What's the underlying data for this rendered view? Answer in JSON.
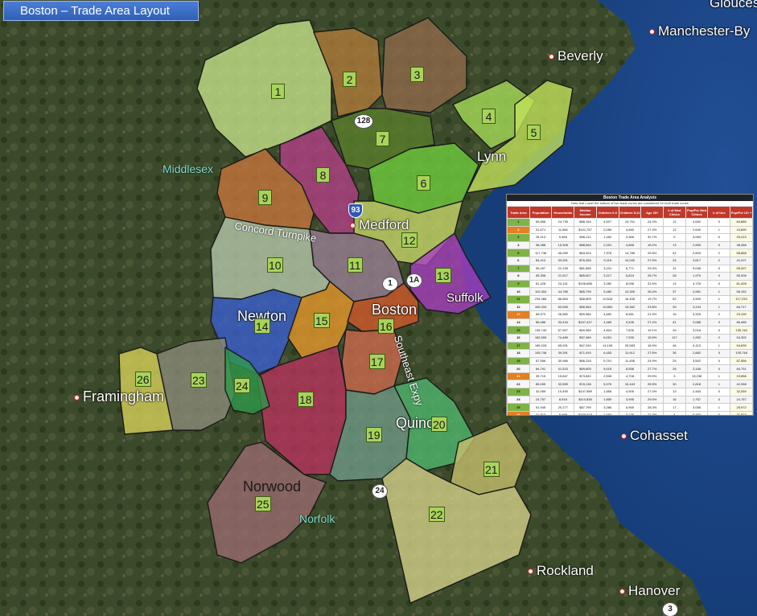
{
  "title": "Boston – Trade Area Layout",
  "colors": {
    "land_dark": "#2d3b22",
    "water": "#1d4b8e",
    "zone_label_bg": "#a8d35a",
    "table_header": "#c0392b"
  },
  "zones": [
    {
      "id": "1",
      "color": "#c6e48a"
    },
    {
      "id": "2",
      "color": "#b07b3a"
    },
    {
      "id": "3",
      "color": "#8f6a4a"
    },
    {
      "id": "4",
      "color": "#a6df5a"
    },
    {
      "id": "5",
      "color": "#c3e35a"
    },
    {
      "id": "6",
      "color": "#6fce3e"
    },
    {
      "id": "7",
      "color": "#5a7f2b"
    },
    {
      "id": "8",
      "color": "#b43f86"
    },
    {
      "id": "9",
      "color": "#c8743c"
    },
    {
      "id": "10",
      "color": "#b7c9ad"
    },
    {
      "id": "11",
      "color": "#9a7f96"
    },
    {
      "id": "12",
      "color": "#c8d86a"
    },
    {
      "id": "13",
      "color": "#a63ec0"
    },
    {
      "id": "14",
      "color": "#3a5fd2"
    },
    {
      "id": "15",
      "color": "#e8982a"
    },
    {
      "id": "16",
      "color": "#d4582a"
    },
    {
      "id": "17",
      "color": "#cf6a4e"
    },
    {
      "id": "18",
      "color": "#b8325e"
    },
    {
      "id": "19",
      "color": "#6f9a86"
    },
    {
      "id": "20",
      "color": "#4fb86e"
    },
    {
      "id": "21",
      "color": "#c8c06e"
    },
    {
      "id": "22",
      "color": "#d6d48a"
    },
    {
      "id": "23",
      "color": "#8c8c7a"
    },
    {
      "id": "24",
      "color": "#2f9a4a"
    },
    {
      "id": "25",
      "color": "#9a6a70"
    },
    {
      "id": "26",
      "color": "#d8d45a"
    }
  ],
  "places": {
    "gloucester": "Glouces",
    "manchester": "Manchester-By",
    "beverly": "Beverly",
    "lynn": "Lynn",
    "middlesex": "Middlesex",
    "medford": "Medford",
    "concord_turnpike": "Concord Turnpike",
    "suffolk": "Suffolk",
    "newton": "Newton",
    "boston": "Boston",
    "southeast_expy": "Southeast Expy",
    "framingham": "Framingham",
    "quincy": "Quinc",
    "cohasset": "Cohasset",
    "norwood": "Norwood",
    "norfolk": "Norfolk",
    "rockland": "Rockland",
    "hanover": "Hanover"
  },
  "shields": {
    "r128": "128",
    "i93": "93",
    "r1": "1",
    "r1a": "1A",
    "r24": "24",
    "r3": "3"
  },
  "table": {
    "title": "Boston Trade Area Analysis",
    "subtitle": "Note that Lowel the bottom of two trade zones are considered for both trade zones",
    "headers": [
      "Trade Area",
      "Population",
      "Households",
      "Median Income",
      "Children 0-5",
      "Children 5-11",
      "Age 25+",
      "# of Med Clinics",
      "Pop/Per Med Clinics",
      "# of Ucs",
      "Pop/Per UC +"
    ],
    "highlight_rows": [
      "2",
      "13",
      "21",
      "26"
    ],
    "rows": [
      [
        "1",
        "69,896",
        "24,739",
        "$88,154",
        "4,507",
        "10,761",
        "24.0%",
        "12",
        "4,652",
        "0",
        "69,885"
      ],
      [
        "2",
        "31,671",
        "11,560",
        "$101,757",
        "2,059",
        "4,650",
        "27.3%",
        "12",
        "2,640",
        "1",
        "15,890"
      ],
      [
        "3",
        "25,413",
        "9,466",
        "$96,211",
        "1,452",
        "3,366",
        "32.7%",
        "5",
        "5,083",
        "0",
        "25,413"
      ],
      [
        "4",
        "38,388",
        "15,308",
        "$88,064",
        "2,291",
        "4,668",
        "18.2%",
        "13",
        "2,950",
        "0",
        "38,388"
      ],
      [
        "5",
        "117,736",
        "46,059",
        "$63,924",
        "7,976",
        "14,785",
        "25.8%",
        "42",
        "2,803",
        "2",
        "58,868"
      ],
      [
        "6",
        "84,414",
        "33,301",
        "$76,326",
        "5,118",
        "10,040",
        "27.9%",
        "24",
        "3,517",
        "2",
        "42,207"
      ],
      [
        "7",
        "55,497",
        "22,135",
        "$81,656",
        "3,231",
        "6,771",
        "29.3%",
        "11",
        "5,045",
        "0",
        "55,497"
      ],
      [
        "8",
        "55,308",
        "21,517",
        "$85,607",
        "3,217",
        "6,824",
        "28.7%",
        "28",
        "1,975",
        "0",
        "55,308"
      ],
      [
        "9",
        "61,428",
        "24,141",
        "$106,688",
        "3,282",
        "8,096",
        "31.6%",
        "13",
        "4,725",
        "0",
        "61,428"
      ],
      [
        "10",
        "110,304",
        "44,785",
        "$85,799",
        "5,480",
        "10,300",
        "26.4%",
        "37",
        "2,981",
        "1",
        "55,152"
      ],
      [
        "11",
        "234,466",
        "86,684",
        "$68,809",
        "10,616",
        "16,406",
        "19.7%",
        "52",
        "4,509",
        "1",
        "117,233"
      ],
      [
        "12",
        "169,434",
        "63,555",
        "$56,554",
        "10,853",
        "19,462",
        "23.8%",
        "39",
        "3,134",
        "1",
        "84,717"
      ],
      [
        "13",
        "69,573",
        "26,560",
        "$59,984",
        "4,652",
        "8,581",
        "21.9%",
        "16",
        "4,325",
        "2",
        "23,190"
      ],
      [
        "14",
        "85,486",
        "34,416",
        "$107,437",
        "4,469",
        "9,526",
        "27.4%",
        "41",
        "2,085",
        "0",
        "85,486"
      ],
      [
        "15",
        "135,740",
        "57,907",
        "$69,350",
        "4,824",
        "7,626",
        "19.1%",
        "45",
        "3,016",
        "0",
        "135,740"
      ],
      [
        "16",
        "162,906",
        "74,489",
        "$57,469",
        "6,051",
        "7,930",
        "15.5%",
        "117",
        "1,392",
        "2",
        "54,302"
      ],
      [
        "17",
        "189,228",
        "65,931",
        "$47,249",
        "14,106",
        "25,583",
        "18.9%",
        "46",
        "4,113",
        "1",
        "94,639"
      ],
      [
        "18",
        "105,748",
        "39,391",
        "$71,919",
        "6,453",
        "11,912",
        "27.6%",
        "36",
        "2,882",
        "0",
        "105,748"
      ],
      [
        "19",
        "87,556",
        "30,966",
        "$66,318",
        "5,701",
        "11,458",
        "24.9%",
        "25",
        "3,502",
        "0",
        "87,556"
      ],
      [
        "20",
        "84,791",
        "41,515",
        "$69,605",
        "5,015",
        "8,556",
        "27.7%",
        "26",
        "3,165",
        "0",
        "84,791"
      ],
      [
        "21",
        "39,715",
        "15,847",
        "$73,640",
        "2,508",
        "4,708",
        "29.9%",
        "3",
        "13,238",
        "1",
        "19,858"
      ],
      [
        "22",
        "85,535",
        "32,559",
        "$78,136",
        "5,076",
        "10,443",
        "26.5%",
        "30",
        "2,818",
        "1",
        "42,268"
      ],
      [
        "23",
        "32,059",
        "10,490",
        "$147,589",
        "1,856",
        "4,905",
        "27.4%",
        "13",
        "2,463",
        "0",
        "32,059"
      ],
      [
        "24",
        "24,757",
        "8,918",
        "$110,838",
        "1,859",
        "3,995",
        "29.0%",
        "16",
        "1,767",
        "0",
        "24,757"
      ],
      [
        "25",
        "51,945",
        "20,277",
        "$87,799",
        "3,266",
        "6,965",
        "28.3%",
        "17",
        "3,055",
        "1",
        "25,972"
      ],
      [
        "26",
        "21,813",
        "8,499",
        "$100,618",
        "1,454",
        "3,136",
        "27.3%",
        "4",
        "5,453",
        "0",
        "21,813"
      ]
    ]
  }
}
